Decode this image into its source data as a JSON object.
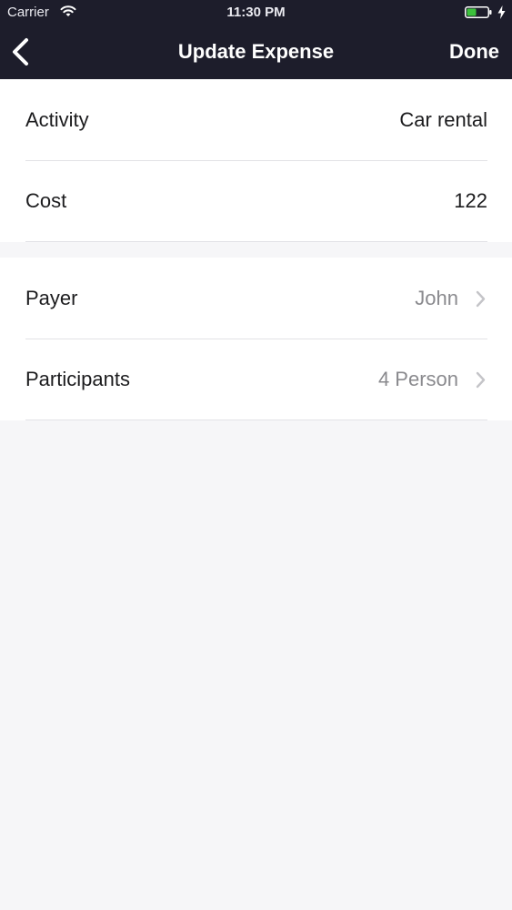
{
  "status_bar": {
    "carrier": "Carrier",
    "time": "11:30 PM",
    "wifi_icon": "wifi-icon",
    "battery_icon": "battery-icon",
    "charging_icon": "bolt-icon",
    "battery_color": "#3cc23c"
  },
  "nav_bar": {
    "back_icon": "chevron-left-icon",
    "title": "Update Expense",
    "done_label": "Done",
    "background": "#1d1d2b"
  },
  "expense": {
    "activity_label": "Activity",
    "activity_value": "Car rental",
    "cost_label": "Cost",
    "cost_value": "122"
  },
  "split": {
    "payer_label": "Payer",
    "payer_value": "John",
    "participants_label": "Participants",
    "participants_value": "4 Person",
    "disclosure_icon": "chevron-right-icon"
  }
}
